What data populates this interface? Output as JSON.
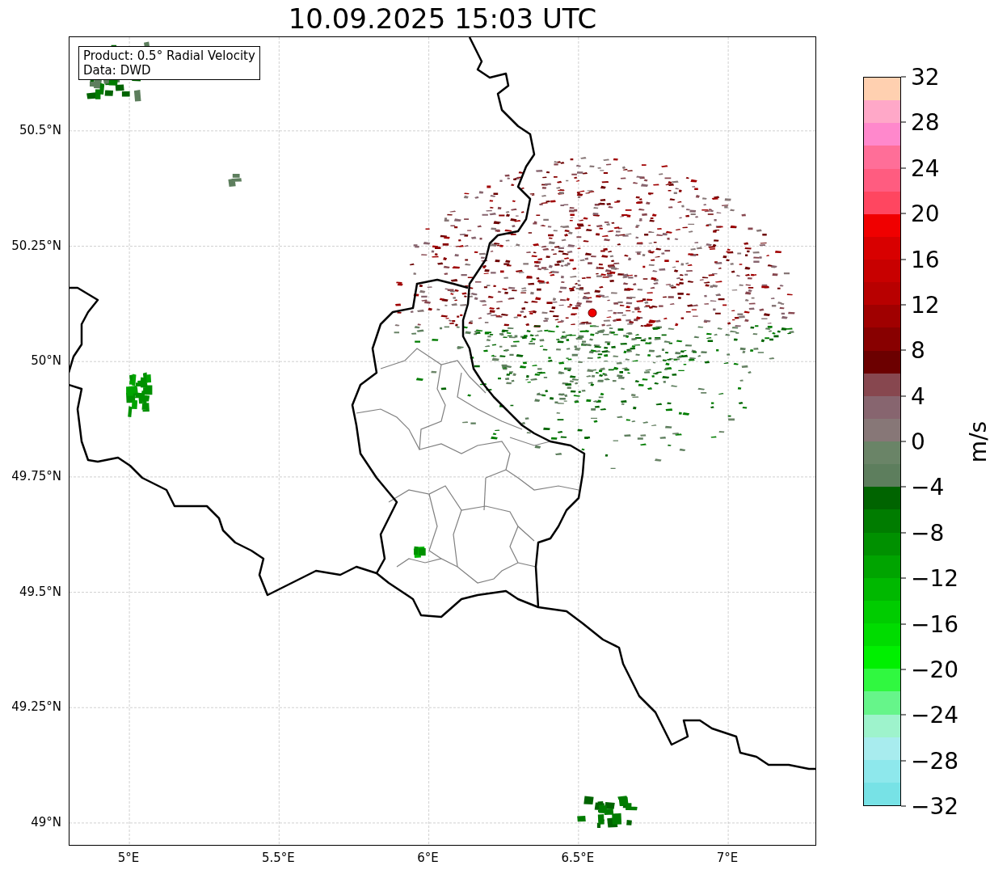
{
  "title": "10.09.2025 15:03 UTC",
  "legend": {
    "lines": [
      "Product: 0.5° Radial Velocity",
      "Data: DWD"
    ]
  },
  "map": {
    "y_ticks": [
      "50.5°N",
      "50.25°N",
      "50°N",
      "49.75°N",
      "49.5°N",
      "49.25°N",
      "49°N"
    ],
    "x_ticks": [
      "5°E",
      "5.5°E",
      "6°E",
      "6.5°E",
      "7°E"
    ]
  },
  "colorbar": {
    "label": "m/s",
    "ticks": [
      "32",
      "28",
      "24",
      "20",
      "16",
      "12",
      "8",
      "4",
      "0",
      "−4",
      "−8",
      "−12",
      "−16",
      "−20",
      "−24",
      "−28",
      "−32"
    ],
    "segments": [
      {
        "color": "#77e2e6"
      },
      {
        "color": "#8ee8ec"
      },
      {
        "color": "#a8ecee"
      },
      {
        "color": "#9ef3cc"
      },
      {
        "color": "#66f58a"
      },
      {
        "color": "#30f840"
      },
      {
        "color": "#00f000"
      },
      {
        "color": "#00dc00"
      },
      {
        "color": "#00cc00"
      },
      {
        "color": "#00b800"
      },
      {
        "color": "#00a400"
      },
      {
        "color": "#009000"
      },
      {
        "color": "#007c00"
      },
      {
        "color": "#006400"
      },
      {
        "color": "#5d7e5d"
      },
      {
        "color": "#6a8467"
      },
      {
        "color": "#877777"
      },
      {
        "color": "#87656f"
      },
      {
        "color": "#87474f"
      },
      {
        "color": "#6c0000"
      },
      {
        "color": "#880000"
      },
      {
        "color": "#a00000"
      },
      {
        "color": "#b80000"
      },
      {
        "color": "#c80000"
      },
      {
        "color": "#d80000"
      },
      {
        "color": "#f00000"
      },
      {
        "color": "#ff4660"
      },
      {
        "color": "#ff5c80"
      },
      {
        "color": "#ff6e98"
      },
      {
        "color": "#ff88cc"
      },
      {
        "color": "#ffa8c8"
      },
      {
        "color": "#ffd0b0"
      }
    ]
  }
}
